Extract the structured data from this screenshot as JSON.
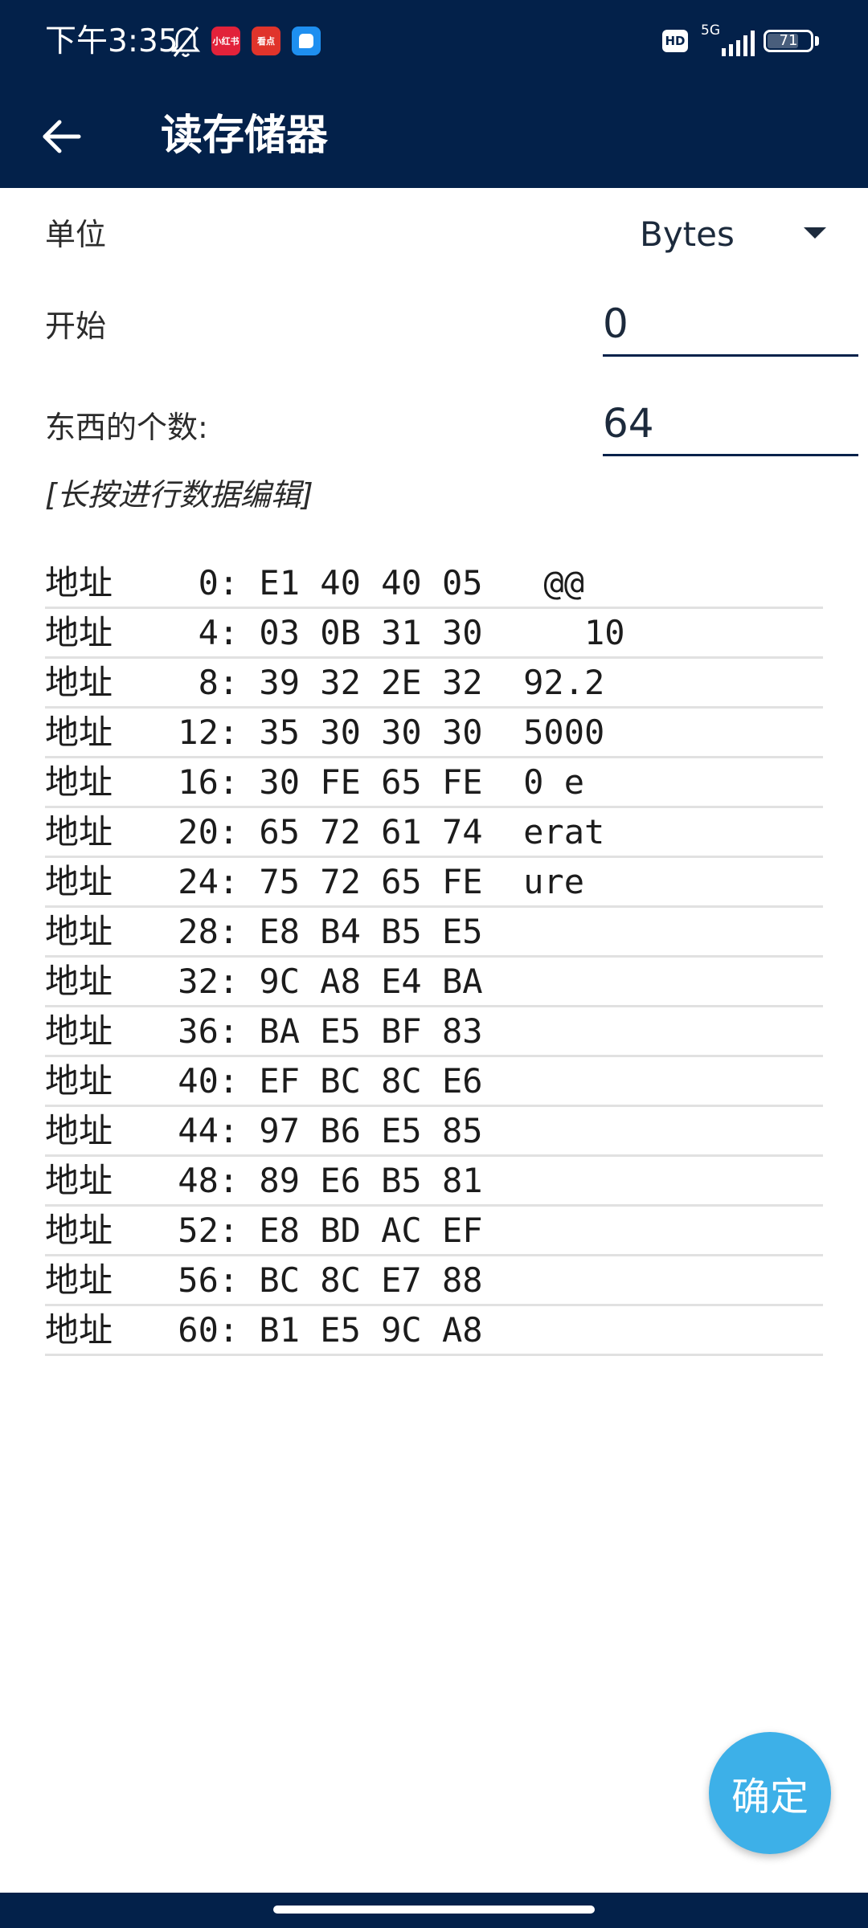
{
  "status": {
    "time": "下午3:35",
    "app_icons": [
      "小红书",
      "看点",
      "消息"
    ],
    "hd": "HD",
    "network": "5G",
    "battery": "71"
  },
  "appbar": {
    "title": "读存储器",
    "back_icon": "arrow-left-icon"
  },
  "form": {
    "unit_label": "单位",
    "unit_value": "Bytes",
    "start_label": "开始",
    "start_value": "0",
    "count_label": "东西的个数:",
    "count_value": "64"
  },
  "hint": "[长按进行数据编辑]",
  "rows": [
    {
      "label": "地址",
      "data": "  0: E1 40 40 05   @@"
    },
    {
      "label": "地址",
      "data": "  4: 03 0B 31 30     10"
    },
    {
      "label": "地址",
      "data": "  8: 39 32 2E 32  92.2"
    },
    {
      "label": "地址",
      "data": " 12: 35 30 30 30  5000"
    },
    {
      "label": "地址",
      "data": " 16: 30 FE 65 FE  0 e"
    },
    {
      "label": "地址",
      "data": " 20: 65 72 61 74  erat"
    },
    {
      "label": "地址",
      "data": " 24: 75 72 65 FE  ure"
    },
    {
      "label": "地址",
      "data": " 28: E8 B4 B5 E5"
    },
    {
      "label": "地址",
      "data": " 32: 9C A8 E4 BA"
    },
    {
      "label": "地址",
      "data": " 36: BA E5 BF 83"
    },
    {
      "label": "地址",
      "data": " 40: EF BC 8C E6"
    },
    {
      "label": "地址",
      "data": " 44: 97 B6 E5 85"
    },
    {
      "label": "地址",
      "data": " 48: 89 E6 B5 81"
    },
    {
      "label": "地址",
      "data": " 52: E8 BD AC EF"
    },
    {
      "label": "地址",
      "data": " 56: BC 8C E7 88"
    },
    {
      "label": "地址",
      "data": " 60: B1 E5 9C A8"
    }
  ],
  "confirm_label": "确定",
  "colors": {
    "bar": "#03214a",
    "fab": "#3db0e8",
    "divider": "#e1e1e1"
  }
}
